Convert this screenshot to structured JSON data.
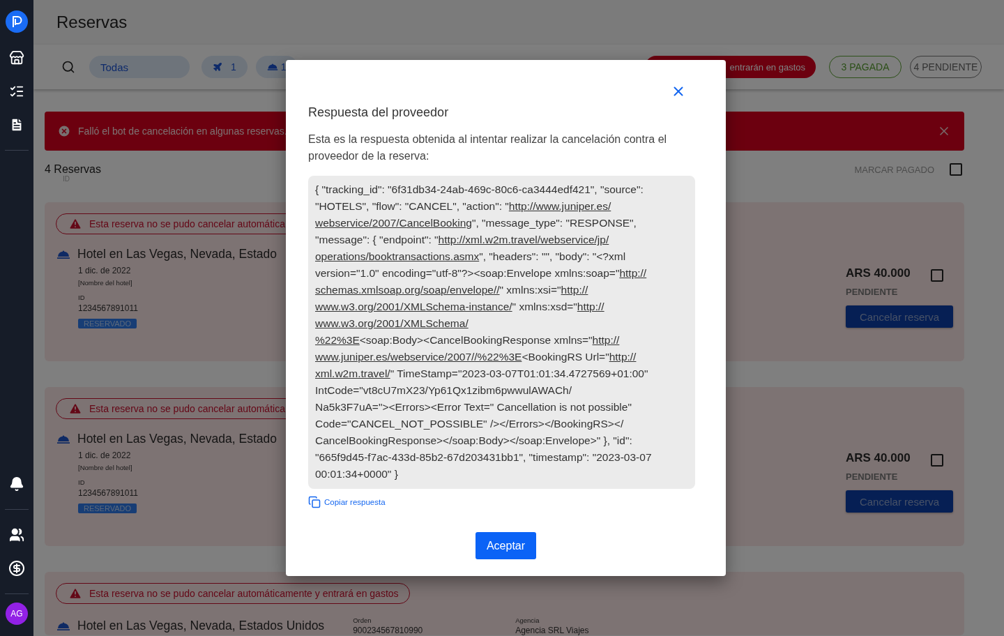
{
  "sidebar": {
    "avatar": "AG"
  },
  "header": {
    "title": "Reservas"
  },
  "filters": [
    {
      "kind": "all",
      "label": "Todas"
    },
    {
      "kind": "flight",
      "label": "1"
    },
    {
      "kind": "hotel",
      "label": "1"
    },
    {
      "kind": "alert",
      "label": "entrarán en gastos"
    },
    {
      "kind": "paid",
      "label": "3 PAGADA"
    },
    {
      "kind": "pending",
      "label": "4 PENDIENTE"
    }
  ],
  "alert": {
    "message": "Falló el bot de cancelación en algunas reservas."
  },
  "summary": {
    "count": "4 Reservas",
    "sub": "ID",
    "mark_paid": "MARCAR PAGADO",
    "checked": false
  },
  "reservations": [
    {
      "warning": "Esta reserva no se pudo cancelar automática",
      "title": "Hotel en Las Vegas, Nevada, Estado",
      "date": "1 dic. de 2022",
      "hotel_name": "[Nombre del hotel]",
      "id_label": "ID",
      "id": "1234567891011",
      "status": "RESERVADO",
      "price": "ARS 40.000",
      "payment": "PENDIENTE",
      "checked": false,
      "action": "Cancelar reserva"
    },
    {
      "warning": "Esta reserva no se pudo cancelar automática",
      "title": "Hotel en Las Vegas, Nevada, Estado",
      "date": "1 dic. de 2022",
      "hotel_name": "[Nombre del hotel]",
      "id_label": "ID",
      "id": "1234567891011",
      "status": "RESERVADO",
      "price": "ARS 40.000",
      "payment": "PENDIENTE",
      "checked": false,
      "action": "Cancelar reserva"
    },
    {
      "warning": "Esta reserva no se pudo cancelar automáticamente y entrará en gastos",
      "title": "Hotel en Las Vegas, Nevada, Estados Unidos",
      "order_label": "Orden",
      "order": "900234567810990",
      "agency_label": "Agencia",
      "agency": "Agencia SRL Viajes"
    }
  ],
  "modal": {
    "title": "Respuesta del proveedor",
    "description": "Esta es la respuesta obtenida al intentar realizar la cancelación contra el proveedor de la reserva:",
    "response": [
      [
        {
          "text": "{ \"tracking_id\": \"6f31db34-24ab-469c-80c6-ca3444edf421\", \"source\":",
          "link": false
        }
      ],
      [
        {
          "text": "\"HOTELS\", \"flow\": \"CANCEL\", \"action\": \"",
          "link": false
        },
        {
          "text": "http://www.juniper.es/",
          "link": true
        }
      ],
      [
        {
          "text": "webservice/2007/CancelBooking",
          "link": true
        },
        {
          "text": "\", \"message_type\": \"RESPONSE\",",
          "link": false
        }
      ],
      [
        {
          "text": "\"message\": { \"endpoint\": \"",
          "link": false
        },
        {
          "text": "http://xml.w2m.travel/webservice/jp/",
          "link": true
        }
      ],
      [
        {
          "text": "operations/booktransactions.asmx",
          "link": true
        },
        {
          "text": "\", \"headers\": \"\", \"body\": \"<?xml",
          "link": false
        }
      ],
      [
        {
          "text": "version=\"1.0\" encoding=\"utf-8\"?><soap:Envelope xmlns:soap=\"",
          "link": false
        },
        {
          "text": "http://",
          "link": true
        }
      ],
      [
        {
          "text": "schemas.xmlsoap.org/soap/envelope//",
          "link": true
        },
        {
          "text": "\" xmlns:xsi=\"",
          "link": false
        },
        {
          "text": "http://",
          "link": true
        }
      ],
      [
        {
          "text": "www.w3.org/2001/XMLSchema-instance/",
          "link": true
        },
        {
          "text": "\" xmlns:xsd=\"",
          "link": false
        },
        {
          "text": "http://",
          "link": true
        }
      ],
      [
        {
          "text": "www.w3.org/2001/XMLSchema/",
          "link": true
        }
      ],
      [
        {
          "text": "%22%3E",
          "link": true
        },
        {
          "text": "<soap:Body><CancelBookingResponse xmlns=\"",
          "link": false
        },
        {
          "text": "http://",
          "link": true
        }
      ],
      [
        {
          "text": "www.juniper.es/webservice/2007//%22%3E",
          "link": true
        },
        {
          "text": "<BookingRS Url=\"",
          "link": false
        },
        {
          "text": "http://",
          "link": true
        }
      ],
      [
        {
          "text": "xml.w2m.travel/",
          "link": true
        },
        {
          "text": "\" TimeStamp=\"2023-03-07T01:01:34.4727569+01:00\"",
          "link": false
        }
      ],
      [
        {
          "text": "IntCode=\"vt8cU7mX23/Yp61Qx1zibm6pwwulAWACh/",
          "link": false
        }
      ],
      [
        {
          "text": "Na5k3F7uA=\"><Errors><Error Text=\" Cancellation is not possible\"",
          "link": false
        }
      ],
      [
        {
          "text": "Code=\"CANCEL_NOT_POSSIBLE\" /></Errors></BookingRS></",
          "link": false
        }
      ],
      [
        {
          "text": "CancelBookingResponse></soap:Body></soap:Envelope>\" }, \"id\":",
          "link": false
        }
      ],
      [
        {
          "text": "\"665f9d45-f7ac-433d-85b2-67d203431bb1\", \"timestamp\": \"2023-03-07",
          "link": false
        }
      ],
      [
        {
          "text": "00:01:34+0000\" }",
          "link": false
        }
      ]
    ],
    "copy": "Copiar respuesta",
    "accept": "Aceptar"
  }
}
